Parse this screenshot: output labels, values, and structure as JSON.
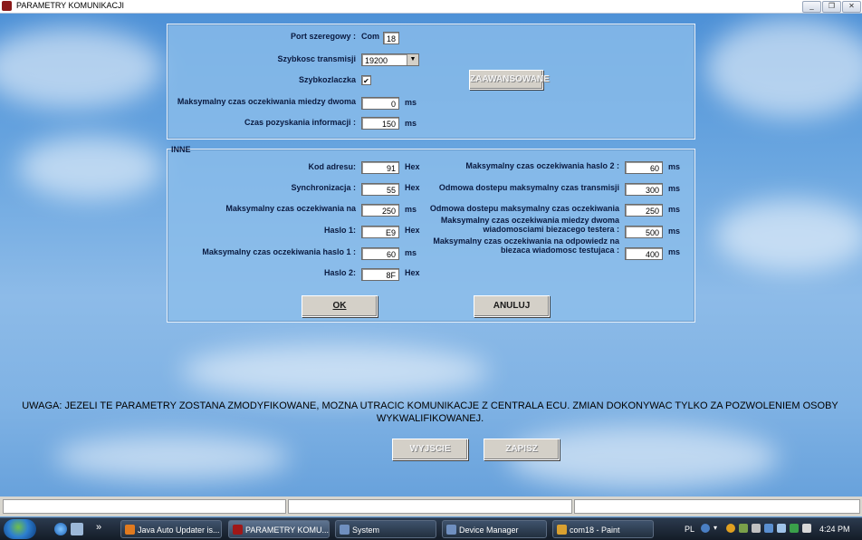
{
  "window": {
    "title": "PARAMETRY KOMUNIKACJI",
    "minimize": "_",
    "restore": "❐",
    "close": "✕"
  },
  "top_panel": {
    "port_label": "Port szeregowy :",
    "port_prefix": "Com",
    "port_value": "18",
    "speed_label": "Szybkosc transmisji",
    "speed_value": "19200",
    "fast_label": "Szybkozlaczka",
    "fast_checked": "✔",
    "max_wait_label": "Maksymalny czas oczekiwania miedzy dwoma",
    "max_wait_value": "0",
    "max_wait_unit": "ms",
    "info_label": "Czas pozyskania informacji :",
    "info_value": "150",
    "info_unit": "ms",
    "advanced_button": "ZAAWANSOWANE"
  },
  "inne": {
    "group_label": "INNE",
    "left": [
      {
        "label": "Kod adresu:",
        "value": "91",
        "unit": "Hex"
      },
      {
        "label": "Synchronizacja :",
        "value": "55",
        "unit": "Hex"
      },
      {
        "label": "Maksymalny czas oczekiwania na",
        "value": "250",
        "unit": "ms"
      },
      {
        "label": "Haslo 1:",
        "value": "E9",
        "unit": "Hex"
      },
      {
        "label": "Maksymalny czas oczekiwania haslo 1 :",
        "value": "60",
        "unit": "ms"
      },
      {
        "label": "Haslo 2:",
        "value": "8F",
        "unit": "Hex"
      }
    ],
    "right": [
      {
        "label": "Maksymalny czas oczekiwania haslo 2 :",
        "value": "60",
        "unit": "ms"
      },
      {
        "label": "Odmowa dostepu maksymalny czas transmisji",
        "value": "300",
        "unit": "ms"
      },
      {
        "label": "Odmowa dostepu maksymalny czas oczekiwania",
        "value": "250",
        "unit": "ms"
      },
      {
        "label": "Maksymalny czas oczekiwania miedzy dwoma",
        "label2": "wiadomosciami biezacego testera :",
        "value": "500",
        "unit": "ms"
      },
      {
        "label": "Maksymalny czas oczekiwania na odpowiedz na",
        "label2": "biezaca wiadomosc testujaca :",
        "value": "400",
        "unit": "ms"
      }
    ],
    "ok_button": "OK",
    "cancel_button": "ANULUJ"
  },
  "warning": "UWAGA: JEZELI TE PARAMETRY ZOSTANA ZMODYFIKOWANE, MOZNA UTRACIC KOMUNIKACJE Z CENTRALA ECU. ZMIAN DOKONYWAC TYLKO ZA POZWOLENIEM OSOBY WYKWALIFIKOWANEJ.",
  "bottom_buttons": {
    "exit": "WYJSCIE",
    "save": "ZAPISZ"
  },
  "taskbar": {
    "chevron": "»",
    "tasks": [
      {
        "label": "Java Auto Updater is...",
        "color": "#e07a1f"
      },
      {
        "label": "PARAMETRY KOMU...",
        "color": "#a01818"
      },
      {
        "label": "System",
        "color": "#6f8fbf"
      },
      {
        "label": "Device Manager",
        "color": "#6f8fbf"
      },
      {
        "label": "com18 - Paint",
        "color": "#d9a030"
      }
    ],
    "lang": "PL",
    "clock": "4:24 PM"
  }
}
